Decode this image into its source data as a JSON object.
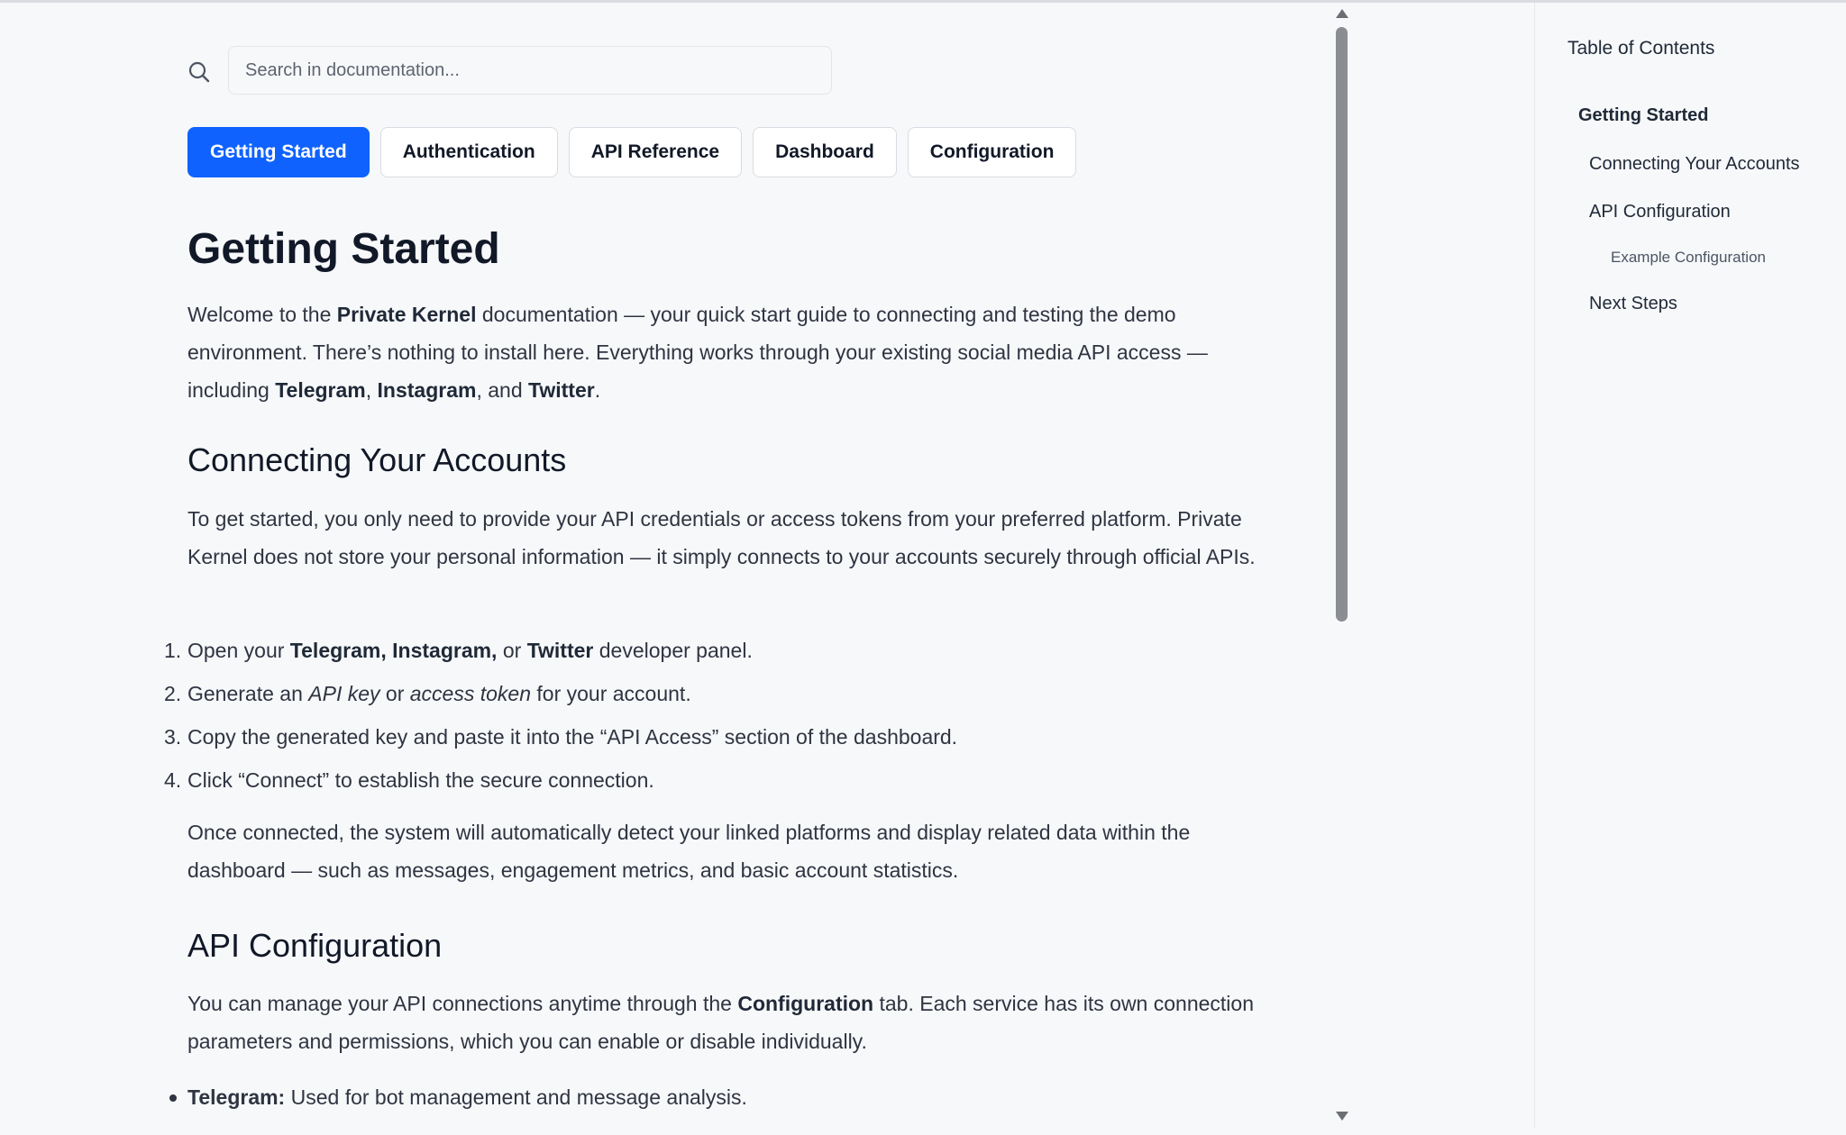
{
  "search": {
    "placeholder": "Search in documentation..."
  },
  "tabs": [
    {
      "label": "Getting Started",
      "active": true
    },
    {
      "label": "Authentication"
    },
    {
      "label": "API Reference"
    },
    {
      "label": "Dashboard"
    },
    {
      "label": "Configuration"
    }
  ],
  "page": {
    "title": "Getting Started",
    "intro": {
      "t1": "Welcome to the ",
      "b1": "Private Kernel",
      "t2": " documentation — your quick start guide to connecting and testing the demo environment. There’s nothing to install here. Everything works through your existing social media API access — including ",
      "b2": "Telegram",
      "t3": ", ",
      "b3": "Instagram",
      "t4": ", and ",
      "b4": "Twitter",
      "t5": "."
    },
    "section1": {
      "heading": "Connecting Your Accounts",
      "para": "To get started, you only need to provide your API credentials or access tokens from your preferred platform. Private Kernel does not store your personal information — it simply connects to your accounts securely through official APIs.",
      "steps": [
        {
          "num": "1.",
          "t1": "Open your ",
          "b1": "Telegram, Instagram,",
          "t2": " or ",
          "b2": "Twitter",
          "t3": " developer panel."
        },
        {
          "num": "2.",
          "t1": "Generate an ",
          "i1": "API key",
          "t2": " or ",
          "i2": "access token",
          "t3": " for your account."
        },
        {
          "num": "3.",
          "text": "Copy the generated key and paste it into the “API Access” section of the dashboard."
        },
        {
          "num": "4.",
          "text": "Click “Connect” to establish the secure connection."
        }
      ],
      "after": "Once connected, the system will automatically detect your linked platforms and display related data within the dashboard — such as messages, engagement metrics, and basic account statistics."
    },
    "section2": {
      "heading": "API Configuration",
      "t1": "You can manage your API connections anytime through the ",
      "b1": "Configuration",
      "t2": " tab. Each service has its own connection parameters and permissions, which you can enable or disable individually.",
      "bullets": [
        {
          "b": "Telegram:",
          "t": " Used for bot management and message analysis."
        }
      ]
    }
  },
  "toc": {
    "title": "Table of Contents",
    "items": [
      {
        "label": "Getting Started",
        "level": 1
      },
      {
        "label": "Connecting Your Accounts",
        "level": 2
      },
      {
        "label": "API Configuration",
        "level": 2
      },
      {
        "label": "Example Configuration",
        "level": 3
      },
      {
        "label": "Next Steps",
        "level": 2
      }
    ]
  },
  "colors": {
    "accent": "#0f62fe",
    "background": "#f7f8fa",
    "text": "#1f2937"
  },
  "icons": {
    "search": "search-icon",
    "scroll_up": "arrow-up-icon",
    "scroll_down": "arrow-down-icon"
  }
}
